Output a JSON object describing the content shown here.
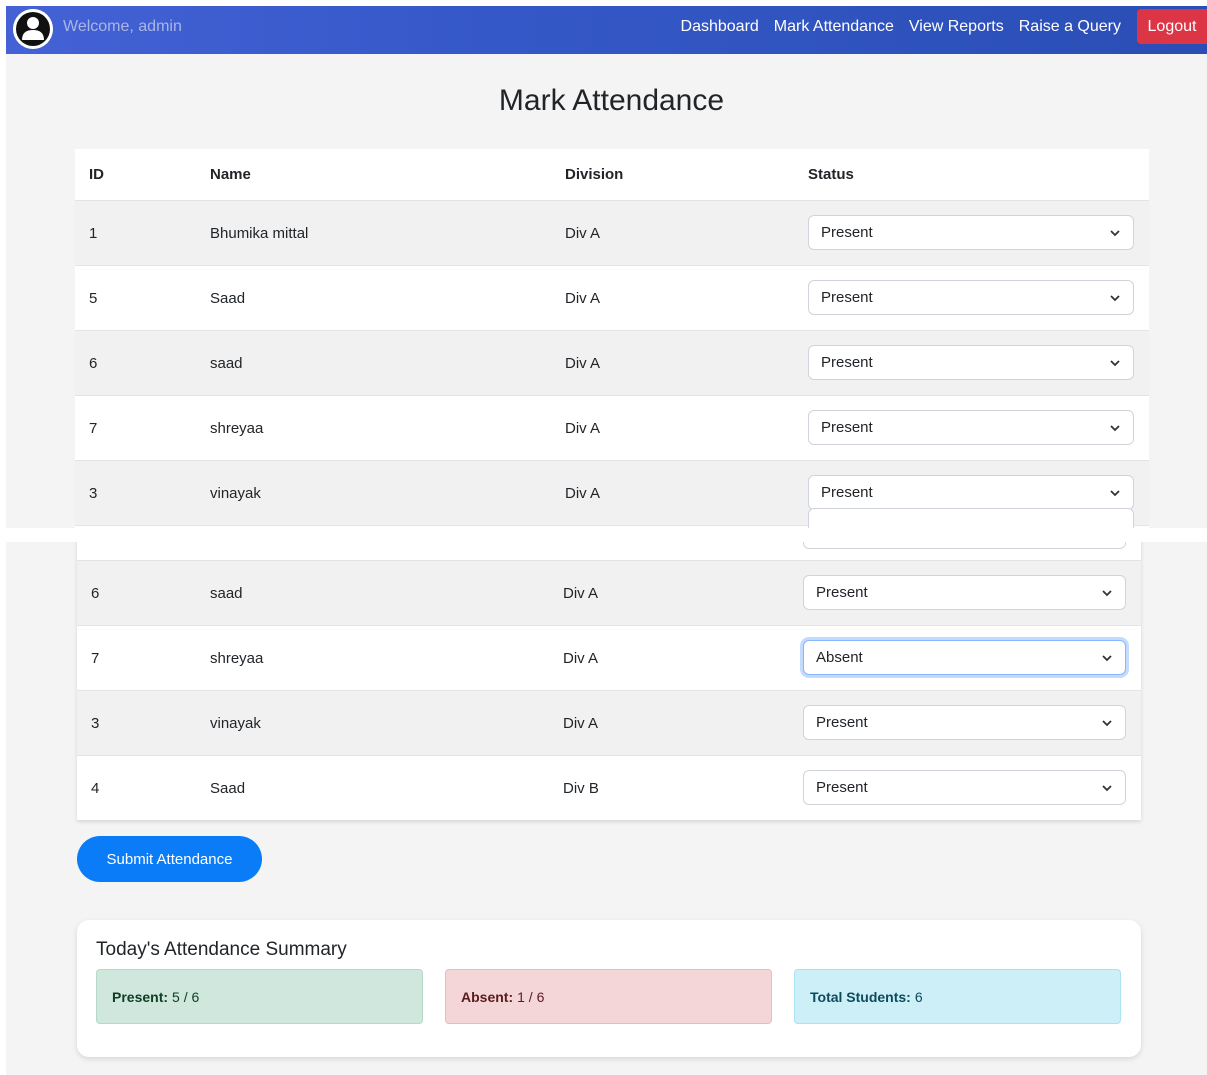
{
  "navbar": {
    "welcome": "Welcome, admin",
    "links": [
      "Dashboard",
      "Mark Attendance",
      "View Reports",
      "Raise a Query"
    ],
    "logout": "Logout"
  },
  "page_title": "Mark Attendance",
  "table": {
    "headers": [
      "ID",
      "Name",
      "Division",
      "Status"
    ],
    "rows_top": [
      {
        "id": "1",
        "name": "Bhumika mittal",
        "division": "Div A",
        "status": "Present"
      },
      {
        "id": "5",
        "name": "Saad",
        "division": "Div A",
        "status": "Present"
      },
      {
        "id": "6",
        "name": "saad",
        "division": "Div A",
        "status": "Present"
      },
      {
        "id": "7",
        "name": "shreyaa",
        "division": "Div A",
        "status": "Present"
      },
      {
        "id": "3",
        "name": "vinayak",
        "division": "Div A",
        "status": "Present"
      }
    ],
    "rows_bottom": [
      {
        "id": "6",
        "name": "saad",
        "division": "Div A",
        "status": "Present"
      },
      {
        "id": "7",
        "name": "shreyaa",
        "division": "Div A",
        "status": "Absent"
      },
      {
        "id": "3",
        "name": "vinayak",
        "division": "Div A",
        "status": "Present"
      },
      {
        "id": "4",
        "name": "Saad",
        "division": "Div B",
        "status": "Present"
      }
    ]
  },
  "submit_label": "Submit Attendance",
  "summary": {
    "title": "Today's Attendance Summary",
    "present_label": "Present:",
    "present_value": "5 / 6",
    "absent_label": "Absent:",
    "absent_value": "1 / 6",
    "total_label": "Total Students:",
    "total_value": "6"
  },
  "colors": {
    "navbar": "#3558c8",
    "logout": "#dc3545",
    "submit": "#0a7cf8"
  }
}
